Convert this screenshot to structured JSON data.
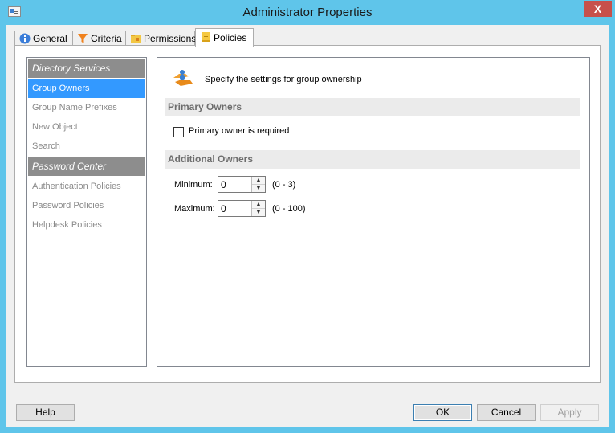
{
  "window": {
    "title": "Administrator Properties",
    "close": "X"
  },
  "tabs": [
    {
      "label": "General",
      "icon": "info-icon"
    },
    {
      "label": "Criteria",
      "icon": "filter-funnel-icon"
    },
    {
      "label": "Permissions",
      "icon": "permissions-folder-icon"
    },
    {
      "label": "Policies",
      "icon": "policies-scroll-icon"
    }
  ],
  "active_tab": "Policies",
  "nav": {
    "groups": [
      {
        "header": "Directory Services",
        "items": [
          "Group Owners",
          "Group Name Prefixes",
          "New Object",
          "Search"
        ]
      },
      {
        "header": "Password Center",
        "items": [
          "Authentication Policies",
          "Password Policies",
          "Helpdesk Policies"
        ]
      }
    ],
    "selected": "Group Owners"
  },
  "content": {
    "header_icon": "group-ownership-icon",
    "header_text": "Specify the settings for group ownership",
    "primary": {
      "title": "Primary Owners",
      "checkbox_label": "Primary owner is required",
      "checked": false
    },
    "additional": {
      "title": "Additional Owners",
      "min_label": "Minimum:",
      "min_value": "0",
      "min_range": "(0 - 3)",
      "max_label": "Maximum:",
      "max_value": "0",
      "max_range": "(0 - 100)"
    }
  },
  "buttons": {
    "help": "Help",
    "ok": "OK",
    "cancel": "Cancel",
    "apply": "Apply"
  },
  "colors": {
    "frame": "#5fc5ea",
    "close": "#c7504b",
    "selection": "#3399ff",
    "nav_header": "#8d8d8d"
  }
}
